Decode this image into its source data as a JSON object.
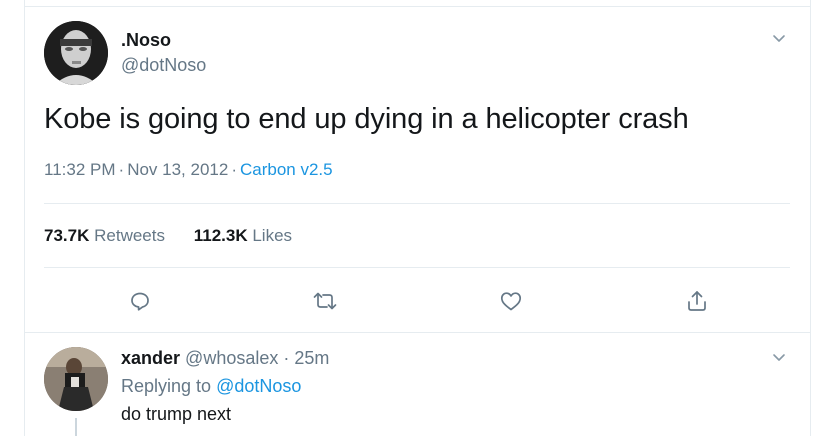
{
  "tweet": {
    "display_name": ".Noso",
    "handle": "@dotNoso",
    "text": "Kobe is going to end up dying in a helicopter crash",
    "time": "11:32 PM",
    "separator": "·",
    "date": "Nov 13, 2012",
    "client": "Carbon v2.5",
    "retweets_count": "73.7K",
    "retweets_label": "Retweets",
    "likes_count": "112.3K",
    "likes_label": "Likes",
    "icons": {
      "more": "chevron-down-icon",
      "reply": "reply-icon",
      "retweet": "retweet-icon",
      "like": "heart-icon",
      "share": "share-icon"
    }
  },
  "reply": {
    "display_name": "xander",
    "handle": "@whosalex",
    "separator": "·",
    "time": "25m",
    "replying_prefix": "Replying to",
    "replying_to": "@dotNoso",
    "text": "do trump next"
  },
  "colors": {
    "text": "#14171a",
    "secondary": "#657786",
    "accent": "#1b95e0",
    "border": "#e6ecf0"
  }
}
